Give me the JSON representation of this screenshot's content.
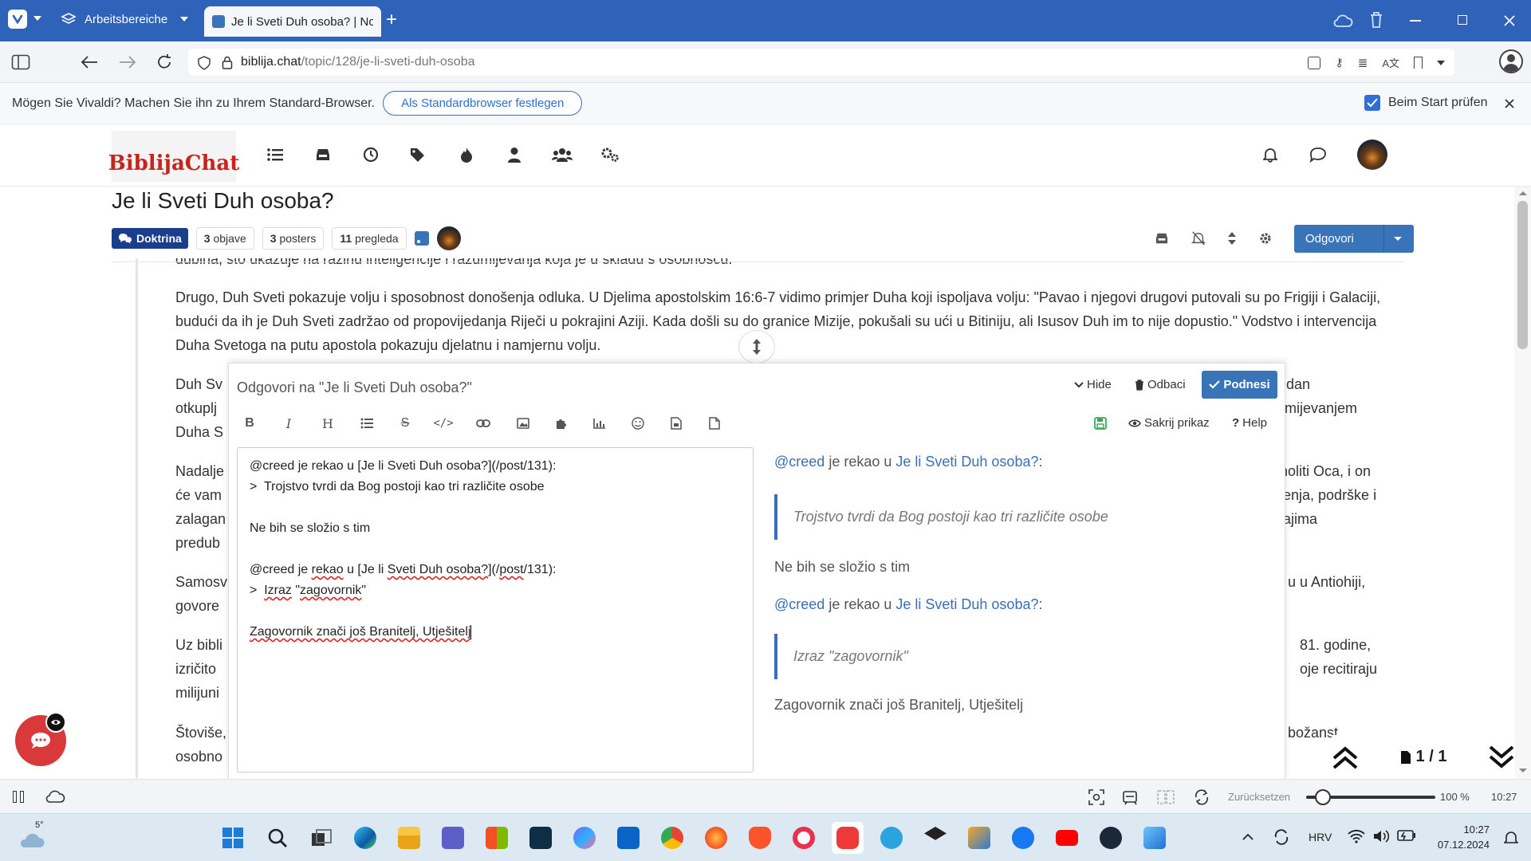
{
  "browser": {
    "workspaces_label": "Arbeitsbereiche",
    "tab_title": "Je li Sveti Duh osoba? | Noc",
    "url_host": "biblija.chat",
    "url_path": "/topic/128/je-li-sveti-duh-osoba",
    "notification": {
      "text": "Mögen Sie Vivaldi? Machen Sie ihn zu Ihrem Standard-Browser.",
      "button": "Als Standardbrowser festlegen",
      "checkbox_label": "Beim Start prüfen"
    }
  },
  "site": {
    "logo_text": "BiblijaChat",
    "nav_icons": [
      "list-icon",
      "inbox-icon",
      "clock-icon",
      "tags-icon",
      "fire-icon",
      "user-icon",
      "users-icon",
      "cogs-icon"
    ]
  },
  "topic": {
    "title": "Je li Sveti Duh osoba?",
    "category": "Doktrina",
    "posts_count": "3",
    "posts_label": "objave",
    "posters_count": "3",
    "posters_label": "posters",
    "views_count": "11",
    "views_label": "pregleda",
    "reply_button": "Odgovori"
  },
  "post": {
    "p0": "dubina, što ukazuje na razinu inteligencije i razumijevanja koja je u skladu s osobnošću.",
    "p1": "Drugo, Duh Sveti pokazuje volju i sposobnost donošenja odluka. U Djelima apostolskim 16:6-7 vidimo primjer Duha koji ispoljava volju: \"Pavao i njegovi drugovi putovali su po Frigiji i Galaciji, budući da ih je Duh Sveti zadržao od propovijedanja Riječi u pokrajini Aziji. Kada došli su do granice Mizije, pokušali su ući u Bitiniju, ali Isusov Duh im to nije dopustio.\" Vodstvo i intervencija Duha Svetoga na putu apostola pokazuju djelatnu i namjernu volju.",
    "p2_left": "Duh Sv",
    "p2_left2": "otkuplj",
    "p2_left3": "Duha S",
    "p2_right": "i za dan",
    "p2_right2": "razumijevanjem",
    "p3_left": "Nadalje",
    "p3_left2": "će vam",
    "p3_left3": "zalagan",
    "p3_left4": "predub",
    "p3_right": "moliti Oca, i on",
    "p3_right2": "ženja, podrške i",
    "p3_right3": "sajima",
    "p4_left": "Samosv",
    "p4_left2": "govore",
    "p4_right": "u u Antiohiji,",
    "p5_left": "Uz bibli",
    "p5_left2": "izričito",
    "p5_left3": "milijuni",
    "p5_right": "81. godine,",
    "p5_right2": "oje recitiraju",
    "p6_left": "Štoviše,",
    "p6_left2": "osobno",
    "p6_right": "božanst"
  },
  "composer": {
    "title": "Odgovori na \"Je li Sveti Duh osoba?\"",
    "hide": "Hide",
    "discard": "Odbaci",
    "submit": "Podnesi",
    "hide_preview": "Sakrij prikaz",
    "help": "Help",
    "editor": {
      "l1": "@creed je rekao u [Je li Sveti Duh osoba?](/post/131):",
      "l2": ">  Trojstvo tvrdi da Bog postoji kao tri različite osobe",
      "l3": "Ne bih se složio s tim",
      "l4_a": "@creed je ",
      "l4_b": "rekao",
      "l4_c": " u [Je li ",
      "l4_d": "Sveti Duh osoba?",
      "l4_e": "](/",
      "l4_f": "post",
      "l4_g": "/131):",
      "l5_a": ">  ",
      "l5_b": "Izraz",
      "l5_c": " \"",
      "l5_d": "zagovornik",
      "l5_e": "\"",
      "l6": "Zagovornik znači još Branitelj, Utješitelj"
    },
    "preview": {
      "mention": "@creed",
      "said_in": " je rekao u ",
      "link": "Je li Sveti Duh osoba?",
      "colon": ":",
      "quote1": "Trojstvo tvrdi da Bog postoji kao tri različite osobe",
      "text1": "Ne bih se složio s tim",
      "quote2": "Izraz \"zagovornik\"",
      "text2": "Zagovornik znači još Branitelj, Utješitelj"
    }
  },
  "pager": {
    "label": "1 / 1"
  },
  "statusbar": {
    "reset": "Zurücksetzen",
    "zoom": "100 %",
    "time": "10:27",
    "zoom_level": 0.07
  },
  "taskbar": {
    "weather": "5°",
    "lang": "HRV",
    "time": "10:27",
    "date": "07.12.2024"
  },
  "colors": {
    "accent": "#3973b8",
    "titlebar": "#2f63ba",
    "category": "#1a3e8c",
    "logo": "#c8241d",
    "chat": "#d9393b"
  }
}
